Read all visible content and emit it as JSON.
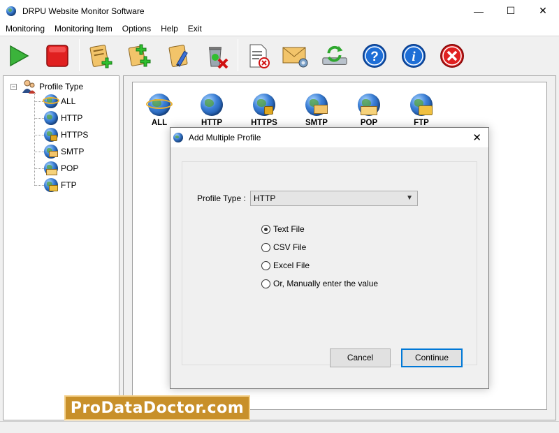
{
  "window": {
    "title": "DRPU Website Monitor Software",
    "minimize": "—",
    "maximize": "☐",
    "close": "✕"
  },
  "menu": [
    "Monitoring",
    "Monitoring Item",
    "Options",
    "Help",
    "Exit"
  ],
  "toolbar": {
    "buttons": [
      "start-icon",
      "stop-icon",
      "add-profile-icon",
      "add-multiple-profile-icon",
      "edit-profile-icon",
      "delete-profile-icon",
      "report-icon",
      "email-settings-icon",
      "refresh-icon",
      "help-icon",
      "about-icon",
      "exit-icon"
    ]
  },
  "tree": {
    "root": "Profile Type",
    "expander": "−",
    "items": [
      "ALL",
      "HTTP",
      "HTTPS",
      "SMTP",
      "POP",
      "FTP"
    ]
  },
  "profile_types": [
    "ALL",
    "HTTP",
    "HTTPS",
    "SMTP",
    "POP",
    "FTP"
  ],
  "dialog": {
    "title": "Add Multiple Profile",
    "close": "✕",
    "profile_type_label": "Profile Type :",
    "profile_type_value": "HTTP",
    "options": [
      {
        "label": "Text File",
        "checked": true
      },
      {
        "label": "CSV File",
        "checked": false
      },
      {
        "label": "Excel File",
        "checked": false
      },
      {
        "label": "Or, Manually enter the value",
        "checked": false
      }
    ],
    "cancel": "Cancel",
    "continue": "Continue"
  },
  "watermark": "ProDataDoctor.com",
  "colors": {
    "banner": "#c8902a",
    "accent": "#0078d7",
    "stop": "#e02020",
    "start": "#3bb33b"
  }
}
